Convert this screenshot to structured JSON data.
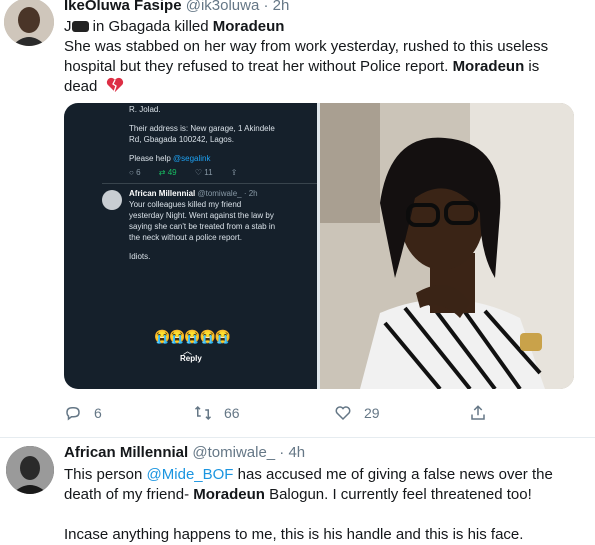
{
  "tweet1": {
    "name": "IkeOluwa Fasipe",
    "handle_time": "@ik3oluwa · 2h",
    "line1_a": "J",
    "line1_b": " in Gbagada killed ",
    "line1_bold": "Moradeun",
    "line2": "She was stabbed on her way from work yesterday, rushed to this useless",
    "line3_a": "hospital but they refused to treat her without Police report. ",
    "line3_bold": "Moradeun",
    "line3_b": " is",
    "line4": "dead",
    "emoji_color": "#dd2e44",
    "actions": {
      "reply": "6",
      "retweet": "66",
      "like": "29"
    }
  },
  "screenshot": {
    "name_line": "R. Jolad.",
    "address_1": "Their address is: New garage, 1 Akindele",
    "address_2": "Rd, Gbagada 100242, Lagos.",
    "please": "Please help ",
    "please_link": "@segalink",
    "counts": {
      "reply": "6",
      "retweet": "49",
      "like": "11"
    },
    "inner_name": "African Millennial",
    "inner_handle": "@tomiwale_ · 2h",
    "inner_1": "Your colleagues killed my friend",
    "inner_2": "yesterday Night. Went against the law by",
    "inner_3": "saying she can't be treated from a stab in",
    "inner_4": "the neck without a police report.",
    "inner_5": "Idiots.",
    "reply_label": "Reply"
  },
  "tweet2": {
    "name": "African Millennial",
    "handle_time": "@tomiwale_ · 4h",
    "line1_a": "This person ",
    "line1_link": "@Mide_BOF",
    "line1_b": " has accused me of giving a false news over the",
    "line2_a": "death of my friend- ",
    "line2_bold": "Moradeun",
    "line2_b": " Balogun. I currently feel threatened too!",
    "line3": "Incase anything happens to me, this is his handle and this is his face."
  },
  "colors": {
    "link": "#1b95e0",
    "muted": "#657786",
    "retweet": "#17bf63"
  }
}
